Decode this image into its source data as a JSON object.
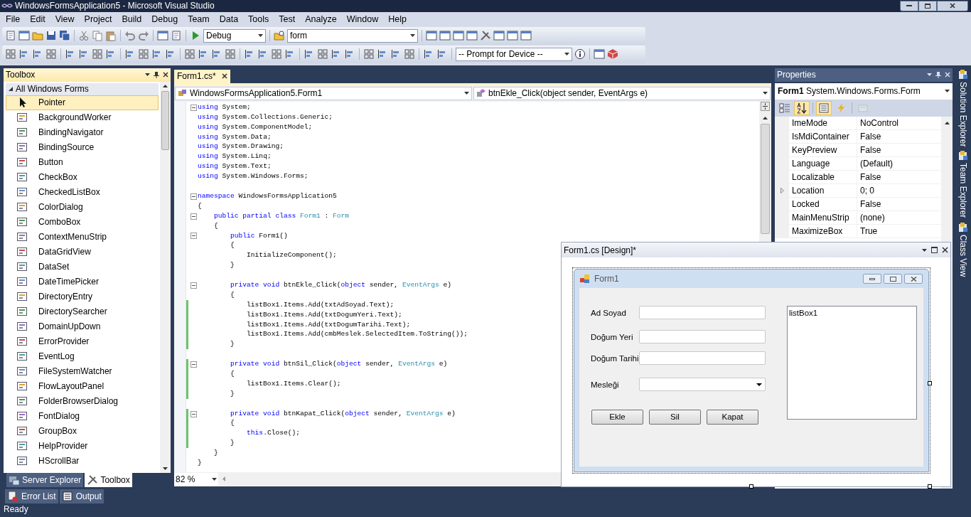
{
  "window": {
    "title": "WindowsFormsApplication5 - Microsoft Visual Studio"
  },
  "menu": [
    "File",
    "Edit",
    "View",
    "Project",
    "Build",
    "Debug",
    "Team",
    "Data",
    "Tools",
    "Test",
    "Analyze",
    "Window",
    "Help"
  ],
  "toolbar": {
    "configuration": "Debug",
    "find": "form",
    "device": "-- Prompt for Device --"
  },
  "toolbox": {
    "title": "Toolbox",
    "group": {
      "label": "All Windows Forms",
      "expanded": true
    },
    "items": [
      {
        "label": "Pointer",
        "selected": true
      },
      {
        "label": "BackgroundWorker",
        "selected": false
      },
      {
        "label": "BindingNavigator",
        "selected": false
      },
      {
        "label": "BindingSource",
        "selected": false
      },
      {
        "label": "Button",
        "selected": false
      },
      {
        "label": "CheckBox",
        "selected": false
      },
      {
        "label": "CheckedListBox",
        "selected": false
      },
      {
        "label": "ColorDialog",
        "selected": false
      },
      {
        "label": "ComboBox",
        "selected": false
      },
      {
        "label": "ContextMenuStrip",
        "selected": false
      },
      {
        "label": "DataGridView",
        "selected": false
      },
      {
        "label": "DataSet",
        "selected": false
      },
      {
        "label": "DateTimePicker",
        "selected": false
      },
      {
        "label": "DirectoryEntry",
        "selected": false
      },
      {
        "label": "DirectorySearcher",
        "selected": false
      },
      {
        "label": "DomainUpDown",
        "selected": false
      },
      {
        "label": "ErrorProvider",
        "selected": false
      },
      {
        "label": "EventLog",
        "selected": false
      },
      {
        "label": "FileSystemWatcher",
        "selected": false
      },
      {
        "label": "FlowLayoutPanel",
        "selected": false
      },
      {
        "label": "FolderBrowserDialog",
        "selected": false
      },
      {
        "label": "FontDialog",
        "selected": false
      },
      {
        "label": "GroupBox",
        "selected": false
      },
      {
        "label": "HelpProvider",
        "selected": false
      },
      {
        "label": "HScrollBar",
        "selected": false
      }
    ]
  },
  "left_tabs": [
    {
      "label": "Server Explorer",
      "selected": false
    },
    {
      "label": "Toolbox",
      "selected": true
    }
  ],
  "editor": {
    "tab": "Form1.cs*",
    "type_selector": "WindowsFormsApplication5.Form1",
    "member_selector": "btnEkle_Click(object sender, EventArgs e)",
    "zoom": "82 %",
    "lines": [
      {
        "collapsible": true,
        "changed": false,
        "space_before": false,
        "tokens": [
          {
            "text": "using",
            "kind": "keyword"
          },
          {
            "text": " System;",
            "kind": "plain"
          }
        ]
      },
      {
        "collapsible": false,
        "changed": false,
        "space_before": false,
        "tokens": [
          {
            "text": "using",
            "kind": "keyword"
          },
          {
            "text": " System.Collections.Generic;",
            "kind": "plain"
          }
        ]
      },
      {
        "collapsible": false,
        "changed": false,
        "space_before": false,
        "tokens": [
          {
            "text": "using",
            "kind": "keyword"
          },
          {
            "text": " System.ComponentModel;",
            "kind": "plain"
          }
        ]
      },
      {
        "collapsible": false,
        "changed": false,
        "space_before": false,
        "tokens": [
          {
            "text": "using",
            "kind": "keyword"
          },
          {
            "text": " System.Data;",
            "kind": "plain"
          }
        ]
      },
      {
        "collapsible": false,
        "changed": false,
        "space_before": false,
        "tokens": [
          {
            "text": "using",
            "kind": "keyword"
          },
          {
            "text": " System.Drawing;",
            "kind": "plain"
          }
        ]
      },
      {
        "collapsible": false,
        "changed": false,
        "space_before": false,
        "tokens": [
          {
            "text": "using",
            "kind": "keyword"
          },
          {
            "text": " System.Linq;",
            "kind": "plain"
          }
        ]
      },
      {
        "collapsible": false,
        "changed": false,
        "space_before": false,
        "tokens": [
          {
            "text": "using",
            "kind": "keyword"
          },
          {
            "text": " System.Text;",
            "kind": "plain"
          }
        ]
      },
      {
        "collapsible": false,
        "changed": false,
        "space_before": false,
        "tokens": [
          {
            "text": "using",
            "kind": "keyword"
          },
          {
            "text": " System.Windows.Forms;",
            "kind": "plain"
          }
        ]
      },
      {
        "collapsible": true,
        "changed": false,
        "space_before": true,
        "tokens": [
          {
            "text": "namespace",
            "kind": "keyword"
          },
          {
            "text": " WindowsFormsApplication5",
            "kind": "plain"
          }
        ]
      },
      {
        "collapsible": false,
        "changed": false,
        "space_before": false,
        "tokens": [
          {
            "text": "{",
            "kind": "plain"
          }
        ]
      },
      {
        "collapsible": true,
        "changed": false,
        "space_before": false,
        "tokens": [
          {
            "text": "    public partial class ",
            "kind": "keyword"
          },
          {
            "text": "Form1",
            "kind": "type"
          },
          {
            "text": " : ",
            "kind": "plain"
          },
          {
            "text": "Form",
            "kind": "type"
          }
        ]
      },
      {
        "collapsible": false,
        "changed": false,
        "space_before": false,
        "tokens": [
          {
            "text": "    {",
            "kind": "plain"
          }
        ]
      },
      {
        "collapsible": true,
        "changed": false,
        "space_before": false,
        "tokens": [
          {
            "text": "        public",
            "kind": "keyword"
          },
          {
            "text": " Form1()",
            "kind": "plain"
          }
        ]
      },
      {
        "collapsible": false,
        "changed": false,
        "space_before": false,
        "tokens": [
          {
            "text": "        {",
            "kind": "plain"
          }
        ]
      },
      {
        "collapsible": false,
        "changed": false,
        "space_before": false,
        "tokens": [
          {
            "text": "            InitializeComponent();",
            "kind": "plain"
          }
        ]
      },
      {
        "collapsible": false,
        "changed": false,
        "space_before": false,
        "tokens": [
          {
            "text": "        }",
            "kind": "plain"
          }
        ]
      },
      {
        "collapsible": true,
        "changed": false,
        "space_before": true,
        "tokens": [
          {
            "text": "        private void",
            "kind": "keyword"
          },
          {
            "text": " btnEkle_Click(",
            "kind": "plain"
          },
          {
            "text": "object",
            "kind": "keyword"
          },
          {
            "text": " sender, ",
            "kind": "plain"
          },
          {
            "text": "EventArgs",
            "kind": "type"
          },
          {
            "text": " e)",
            "kind": "plain"
          }
        ]
      },
      {
        "collapsible": false,
        "changed": false,
        "space_before": false,
        "tokens": [
          {
            "text": "        {",
            "kind": "plain"
          }
        ]
      },
      {
        "collapsible": false,
        "changed": true,
        "space_before": false,
        "tokens": [
          {
            "text": "            listBox1.Items.Add(txtAdSoyad.Text);",
            "kind": "plain"
          }
        ]
      },
      {
        "collapsible": false,
        "changed": true,
        "space_before": false,
        "tokens": [
          {
            "text": "            listBox1.Items.Add(txtDogumYeri.Text);",
            "kind": "plain"
          }
        ]
      },
      {
        "collapsible": false,
        "changed": true,
        "space_before": false,
        "tokens": [
          {
            "text": "            listBox1.Items.Add(txtDogumTarihi.Text);",
            "kind": "plain"
          }
        ]
      },
      {
        "collapsible": false,
        "changed": true,
        "space_before": false,
        "tokens": [
          {
            "text": "            listBox1.Items.Add(cmbMeslek.SelectedItem.ToString());",
            "kind": "plain"
          }
        ]
      },
      {
        "collapsible": false,
        "changed": true,
        "space_before": false,
        "tokens": [
          {
            "text": "        }",
            "kind": "plain"
          }
        ]
      },
      {
        "collapsible": true,
        "changed": true,
        "space_before": true,
        "tokens": [
          {
            "text": "        private void",
            "kind": "keyword"
          },
          {
            "text": " btnSil_Click(",
            "kind": "plain"
          },
          {
            "text": "object",
            "kind": "keyword"
          },
          {
            "text": " sender, ",
            "kind": "plain"
          },
          {
            "text": "EventArgs",
            "kind": "type"
          },
          {
            "text": " e)",
            "kind": "plain"
          }
        ]
      },
      {
        "collapsible": false,
        "changed": true,
        "space_before": false,
        "tokens": [
          {
            "text": "        {",
            "kind": "plain"
          }
        ]
      },
      {
        "collapsible": false,
        "changed": true,
        "space_before": false,
        "tokens": [
          {
            "text": "            listBox1.Items.Clear();",
            "kind": "plain"
          }
        ]
      },
      {
        "collapsible": false,
        "changed": true,
        "space_before": false,
        "tokens": [
          {
            "text": "        }",
            "kind": "plain"
          }
        ]
      },
      {
        "collapsible": true,
        "changed": true,
        "space_before": true,
        "tokens": [
          {
            "text": "        private void",
            "kind": "keyword"
          },
          {
            "text": " btnKapat_Click(",
            "kind": "plain"
          },
          {
            "text": "object",
            "kind": "keyword"
          },
          {
            "text": " sender, ",
            "kind": "plain"
          },
          {
            "text": "EventArgs",
            "kind": "type"
          },
          {
            "text": " e)",
            "kind": "plain"
          }
        ]
      },
      {
        "collapsible": false,
        "changed": true,
        "space_before": false,
        "tokens": [
          {
            "text": "        {",
            "kind": "plain"
          }
        ]
      },
      {
        "collapsible": false,
        "changed": true,
        "space_before": false,
        "tokens": [
          {
            "text": "            this",
            "kind": "keyword"
          },
          {
            "text": ".Close();",
            "kind": "plain"
          }
        ]
      },
      {
        "collapsible": false,
        "changed": true,
        "space_before": false,
        "tokens": [
          {
            "text": "        }",
            "kind": "plain"
          }
        ]
      },
      {
        "collapsible": false,
        "changed": false,
        "space_before": false,
        "tokens": [
          {
            "text": "    }",
            "kind": "plain"
          }
        ]
      },
      {
        "collapsible": false,
        "changed": false,
        "space_before": false,
        "tokens": [
          {
            "text": "}",
            "kind": "plain"
          }
        ]
      }
    ]
  },
  "properties": {
    "title": "Properties",
    "object": "**Form1** System.Windows.Forms.Form",
    "view_buttons": [
      {
        "kind": "categorized",
        "selected": false,
        "disabled": false
      },
      {
        "kind": "alphabetical",
        "selected": true,
        "disabled": false
      },
      {
        "kind": "properties",
        "selected": true,
        "disabled": false
      },
      {
        "kind": "events",
        "selected": false,
        "disabled": false
      },
      {
        "kind": "pages",
        "selected": false,
        "disabled": true
      }
    ],
    "rows": [
      {
        "name": "ImeMode",
        "value": "NoControl",
        "expandable": false
      },
      {
        "name": "IsMdiContainer",
        "value": "False",
        "expandable": false
      },
      {
        "name": "KeyPreview",
        "value": "False",
        "expandable": false
      },
      {
        "name": "Language",
        "value": "(Default)",
        "expandable": false
      },
      {
        "name": "Localizable",
        "value": "False",
        "expandable": false
      },
      {
        "name": "Location",
        "value": "0; 0",
        "expandable": true
      },
      {
        "name": "Locked",
        "value": "False",
        "expandable": false
      },
      {
        "name": "MainMenuStrip",
        "value": "(none)",
        "expandable": false
      },
      {
        "name": "MaximizeBox",
        "value": "True",
        "expandable": false
      }
    ]
  },
  "side_tabs": [
    "Solution Explorer",
    "Team Explorer",
    "Class View"
  ],
  "designer": {
    "title": "Form1.cs [Design]*",
    "form": {
      "title": "Form1",
      "fields": [
        {
          "label": "Ad Soyad",
          "kind": "textbox"
        },
        {
          "label": "Doğum Yeri",
          "kind": "textbox"
        },
        {
          "label": "Doğum Tarihi",
          "kind": "textbox"
        },
        {
          "label": "Mesleği",
          "kind": "combobox"
        }
      ],
      "buttons": [
        "Ekle",
        "Sil",
        "Kapat"
      ],
      "listbox": [
        "listBox1"
      ]
    }
  },
  "bottom_tabs": [
    "Error List",
    "Output"
  ],
  "status_bar": "Ready"
}
